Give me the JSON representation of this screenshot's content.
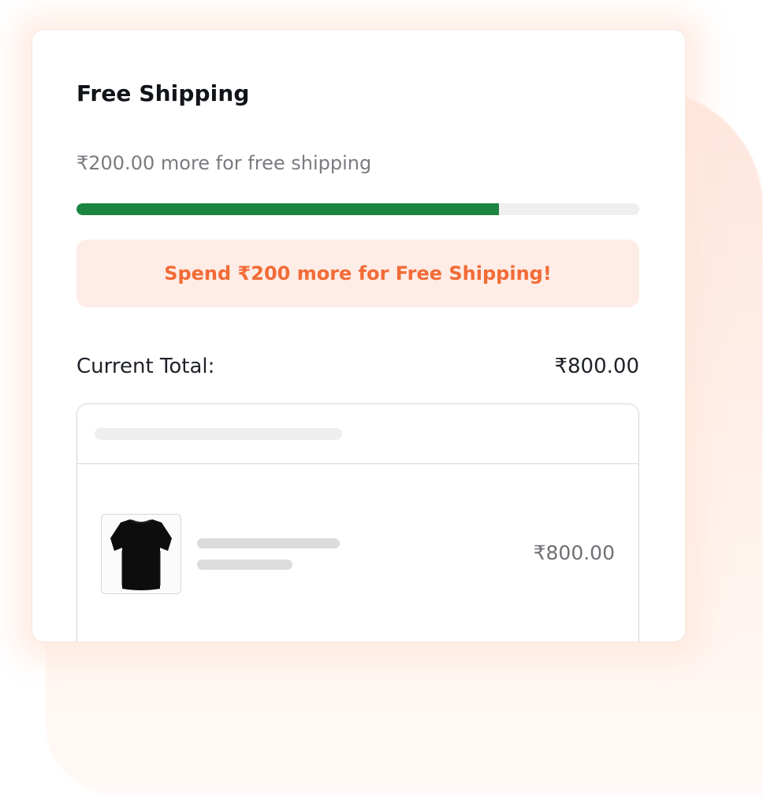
{
  "widget": {
    "title": "Free Shipping",
    "remaining_text": "₹200.00 more for free shipping",
    "progress_percent": 75,
    "promo_message": "Spend ₹200 more for Free Shipping!",
    "total_label": "Current Total:",
    "total_value": "₹800.00"
  },
  "cart": {
    "items": [
      {
        "image_icon": "tshirt-icon",
        "price": "₹800.00"
      }
    ]
  },
  "colors": {
    "progress_fill": "#1c8541",
    "progress_track": "#efefef",
    "promo_background": "#feece6",
    "promo_text": "#f26b36",
    "accent_background": "#fee6dc"
  }
}
